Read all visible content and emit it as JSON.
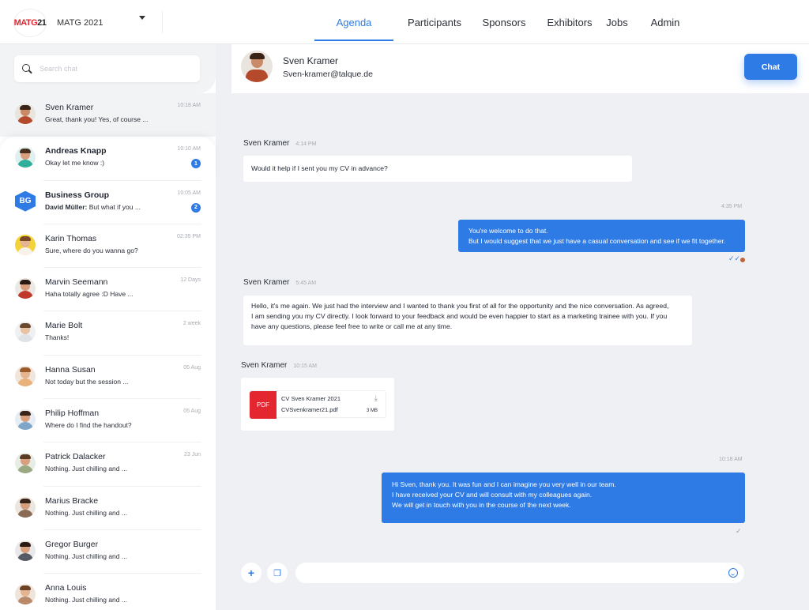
{
  "header": {
    "logo_red": "MATG",
    "logo_dark": "21",
    "event_name": "MATG 2021",
    "nav": [
      {
        "label": "Agenda",
        "active": true
      },
      {
        "label": "Participants",
        "active": false
      },
      {
        "label": "Sponsors",
        "active": false
      },
      {
        "label": "Exhibitors",
        "active": false
      },
      {
        "label": "Jobs",
        "active": false
      },
      {
        "label": "Admin",
        "active": false
      }
    ]
  },
  "sidebar": {
    "search_placeholder": "Search chat",
    "chats": [
      {
        "name": "Sven Kramer",
        "preview": "Great, thank you! Yes, of course ...",
        "time": "10:18 AM"
      },
      {
        "name": "Andreas Knapp",
        "preview": "Okay let me know :)",
        "time": "10:10 AM",
        "unread": "1"
      },
      {
        "name": "Business Group",
        "sender": "David Müller:",
        "preview": "But what if you ...",
        "time": "10:05 AM",
        "unread": "2",
        "initials": "BG"
      },
      {
        "name": "Karin Thomas",
        "preview": "Sure, where do you wanna go?",
        "time": "02:35 PM"
      },
      {
        "name": "Marvin Seemann",
        "preview": "Haha totally agree :D Have ...",
        "time": "12 Days"
      },
      {
        "name": "Marie Bolt",
        "preview": "Thanks!",
        "time": "2 week"
      },
      {
        "name": "Hanna Susan",
        "preview": "Not today but the session ...",
        "time": "05 Aug"
      },
      {
        "name": "Philip Hoffman",
        "preview": "Where do I find the handout?",
        "time": "05 Aug"
      },
      {
        "name": "Patrick Dalacker",
        "preview": "Nothing. Just chilling and ...",
        "time": "23 Jun"
      },
      {
        "name": "Marius Bracke",
        "preview": "Nothing. Just chilling and ...",
        "time": ""
      },
      {
        "name": "Gregor Burger",
        "preview": "Nothing. Just chilling and ...",
        "time": ""
      },
      {
        "name": "Anna Louis",
        "preview": "Nothing. Just chilling and ...",
        "time": ""
      }
    ]
  },
  "conversation": {
    "name": "Sven Kramer",
    "email": "Sven-kramer@talque.de",
    "chat_button": "Chat",
    "messages": {
      "m1": {
        "sender": "Sven Kramer",
        "time": "4:14 PM",
        "text": "Would it help if I sent you my CV in advance?"
      },
      "m2": {
        "time": "4:35 PM",
        "line1": "You're welcome to do that.",
        "line2": "But I would suggest that we just have a casual conversation and see if we fit together."
      },
      "m3": {
        "sender": "Sven Kramer",
        "time": "5:45 AM",
        "line1": "Hello, it's me again. We just had the interview and I wanted to thank you first of all for the opportunity and the nice conversation. As agreed,",
        "line2": "I am sending you my CV directly. I look forward to your feedback and would be even happier to start as a marketing trainee with you. If you",
        "line3": "have any questions, please feel free to write or call me at any time."
      },
      "m4": {
        "sender": "Sven Kramer",
        "time": "10:15 AM",
        "file_type": "PDF",
        "file_title": "CV Sven Kramer 2021",
        "file_name": "CVSvenkramer21.pdf",
        "file_size": "3 MB"
      },
      "m5": {
        "time": "10:18 AM",
        "line1": "Hi Sven, thank you. It was fun and I can imagine you very well in our team.",
        "line2": "I have received your CV and will consult with my colleagues again.",
        "line3": "We will get in touch with you in the course of the next week."
      }
    },
    "composer_placeholder": ""
  },
  "colors": {
    "accent": "#2f7be5",
    "pdf": "#e3262f",
    "background": "#eef0f3"
  }
}
